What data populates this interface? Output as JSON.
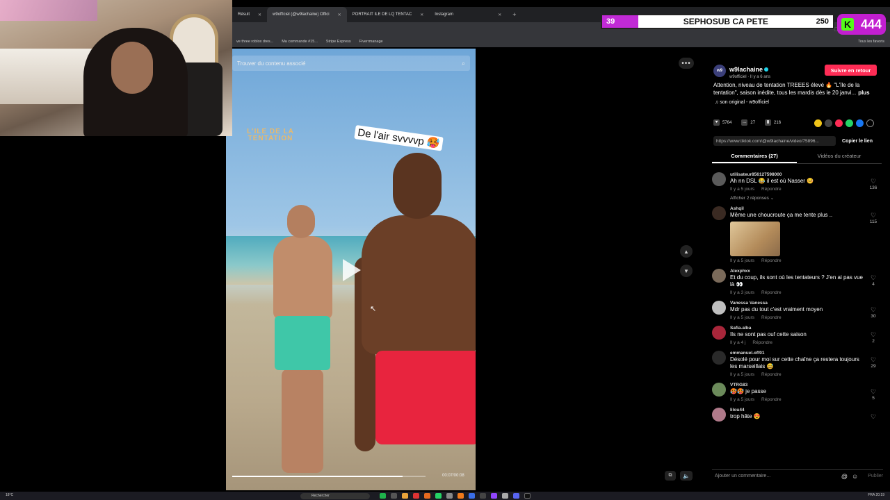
{
  "browser": {
    "tabs": [
      {
        "label": "Résult",
        "active": false
      },
      {
        "label": "w9officiel (@w9lachaine) Offici",
        "active": true
      },
      {
        "label": "PORTRAIT ILE DE LQ TENTAC",
        "active": false
      },
      {
        "label": "Instagram",
        "active": false
      }
    ],
    "bookmarks": [
      "ve three roblox dres...",
      "Ma commande #15...",
      "Stripe Express",
      "Fiverrmanage"
    ],
    "bookmarks_right": "Tous les favoris"
  },
  "overlay": {
    "left_number": "39",
    "text": "SEPHOSUB CA PETE",
    "right_number": "250",
    "kick_count": "444",
    "kick_letter": "K",
    "progress_fraction": 0.156
  },
  "video": {
    "search_placeholder": "Trouver du contenu associé",
    "logo": "L'ILE DE LA TENTATION",
    "caption": "De l'air svvvvp 🥵",
    "time": "00:07/00:08",
    "progress_fraction": 0.88
  },
  "post": {
    "avatar_text": "w9",
    "author": "w9lachaine",
    "handle": "w9officiel",
    "age": "Il y a 6 ans",
    "follow_label": "Suivre en retour",
    "description": "Attention, niveau de tentation TREEES élevé 🔥 \"L'île de la tentation\", saison inédite, tous les mardis dès le 20 janvi...",
    "more_label": "plus",
    "sound": "son original - w9officiel",
    "likes": "5764",
    "comments_count": "27",
    "saves": "216",
    "link": "https://www.tiktok.com/@w9lachaine/video/75896...",
    "copy_label": "Copier le lien",
    "tab_comments": "Commentaires (27)",
    "tab_creator": "Vidéos du créateur"
  },
  "comments": [
    {
      "user": "utilisateur856127598000",
      "text": "Ah nn DSL 😂 il est où Nasser 🤒",
      "age": "Il y a 5 jours",
      "reply": "Répondre",
      "likes": "136",
      "replies": "Afficher 2 réponses ⌄",
      "avatar": "#5a5a5a"
    },
    {
      "user": "Ashqil",
      "text": "Même une choucroute ça me tente plus ..",
      "age": "Il y a 5 jours",
      "reply": "Répondre",
      "likes": "115",
      "gif": true,
      "avatar": "#3a2a22"
    },
    {
      "user": "Alexphxx",
      "text": "Et du coup, ils sont où les tentateurs ? J'en ai pas vue là 👀",
      "age": "Il y a 3 jours",
      "reply": "Répondre",
      "likes": "4",
      "avatar": "#7a6a5a"
    },
    {
      "user": "Vanessa Vanessa",
      "text": "Mdr pas du tout c'est vraiment moyen",
      "age": "Il y a 5 jours",
      "reply": "Répondre",
      "likes": "30",
      "avatar": "#bfbfbf"
    },
    {
      "user": "Safia.alba",
      "text": "Ils ne sont pas ouf cette saison",
      "age": "Il y a 4 j",
      "reply": "Répondre",
      "likes": "2",
      "avatar": "#a8263a"
    },
    {
      "user": "emmanuel.off01",
      "text": "Désolé pour moi sur cette chaîne ça restera toujours les marseillais 😅",
      "age": "Il y a 5 jours",
      "reply": "Répondre",
      "likes": "29",
      "avatar": "#2a2a2a"
    },
    {
      "user": "VTRG83",
      "text": "🥵🥵 je passe",
      "age": "Il y a 5 jours",
      "reply": "Répondre",
      "likes": "5",
      "avatar": "#6b8a5a"
    },
    {
      "user": "lilou44",
      "text": "trop hâte 😍",
      "age": "",
      "reply": "",
      "likes": "",
      "avatar": "#b07a8a"
    }
  ],
  "input": {
    "placeholder": "Ajouter un commentaire...",
    "publish": "Publier"
  },
  "taskbar": {
    "weather": "18°C",
    "search": "Rechercher",
    "tray": "FRA  20:19"
  }
}
